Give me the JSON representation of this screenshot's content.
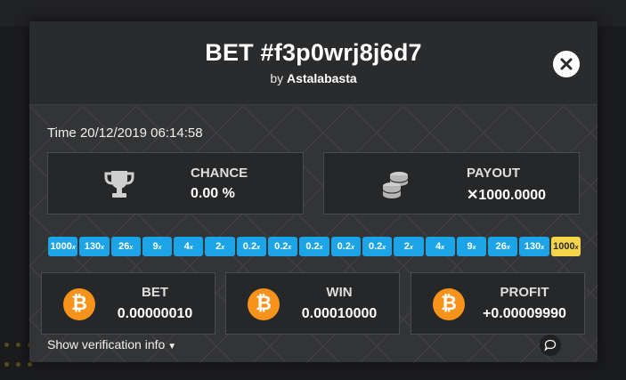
{
  "modal": {
    "title": "BET #f3p0wrj8j6d7",
    "by_prefix": "by",
    "username": "Astalabasta",
    "close_icon": "close-icon",
    "time": "Time 20/12/2019 06:14:58"
  },
  "stats": {
    "chance": {
      "label": "CHANCE",
      "value": "0.00 %",
      "icon": "trophy-icon"
    },
    "payout": {
      "label": "PAYOUT",
      "value": "✕1000.0000",
      "icon": "coins-stack-icon"
    }
  },
  "multipliers": [
    {
      "value": "1000",
      "suffix": "x",
      "highlight": false
    },
    {
      "value": "130",
      "suffix": "x",
      "highlight": false
    },
    {
      "value": "26",
      "suffix": "x",
      "highlight": false
    },
    {
      "value": "9",
      "suffix": "x",
      "highlight": false
    },
    {
      "value": "4",
      "suffix": "x",
      "highlight": false
    },
    {
      "value": "2",
      "suffix": "x",
      "highlight": false
    },
    {
      "value": "0.2",
      "suffix": "x",
      "highlight": false
    },
    {
      "value": "0.2",
      "suffix": "x",
      "highlight": false
    },
    {
      "value": "0.2",
      "suffix": "x",
      "highlight": false
    },
    {
      "value": "0.2",
      "suffix": "x",
      "highlight": false
    },
    {
      "value": "0.2",
      "suffix": "x",
      "highlight": false
    },
    {
      "value": "2",
      "suffix": "x",
      "highlight": false
    },
    {
      "value": "4",
      "suffix": "x",
      "highlight": false
    },
    {
      "value": "9",
      "suffix": "x",
      "highlight": false
    },
    {
      "value": "26",
      "suffix": "x",
      "highlight": false
    },
    {
      "value": "130",
      "suffix": "x",
      "highlight": false
    },
    {
      "value": "1000",
      "suffix": "x",
      "highlight": true
    }
  ],
  "amounts": {
    "bet": {
      "label": "BET",
      "value": "0.00000010",
      "icon": "bitcoin-icon"
    },
    "win": {
      "label": "WIN",
      "value": "0.00010000",
      "icon": "bitcoin-icon"
    },
    "profit": {
      "label": "PROFIT",
      "value": "+0.00009990",
      "icon": "bitcoin-icon"
    }
  },
  "footer": {
    "verify_label": "Show verification info",
    "verify_icon": "chevron-down-icon",
    "chat_icon": "chat-bubble-icon"
  },
  "colors": {
    "multiplier_blue": "#1ba4e8",
    "multiplier_gold": "#f6d44a",
    "bitcoin_orange": "#f7931a",
    "modal_bg": "#333436"
  }
}
